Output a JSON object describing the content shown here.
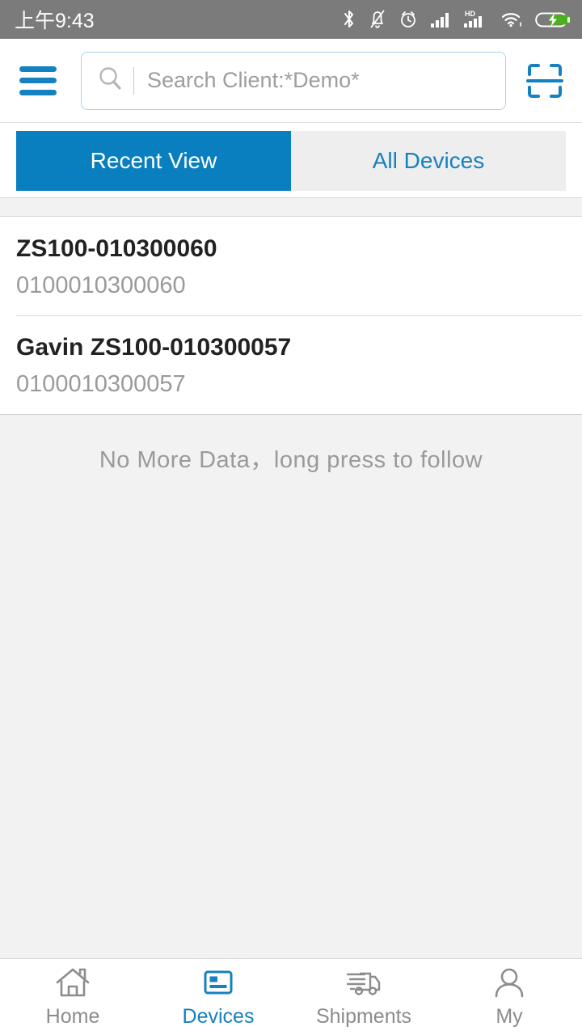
{
  "status_bar": {
    "time": "上午9:43",
    "icons": [
      "bluetooth-icon",
      "bell-muted-icon",
      "alarm-icon",
      "signal-bars-icon",
      "signal-hd-icon",
      "wifi-icon",
      "battery-charging-icon"
    ],
    "background_color": "#7b7b7b",
    "battery_color": "#4caf1e"
  },
  "header": {
    "menu_icon": "hamburger-menu-icon",
    "search": {
      "icon": "search-icon",
      "value": "",
      "placeholder": "Search Client:*Demo*"
    },
    "scan_icon": "barcode-scan-icon",
    "accent_color": "#1581c0"
  },
  "tabs": {
    "items": [
      {
        "label": "Recent View",
        "active": true
      },
      {
        "label": "All Devices",
        "active": false
      }
    ],
    "active_bg": "#0a7fc0",
    "inactive_bg": "#eeeeee",
    "inactive_text": "#1581c0"
  },
  "list": {
    "items": [
      {
        "title": "ZS100-010300060",
        "subtitle": "0100010300060"
      },
      {
        "title": "Gavin ZS100-010300057",
        "subtitle": "0100010300057"
      }
    ]
  },
  "footer_message": "No More Data，long press to follow",
  "bottom_nav": {
    "items": [
      {
        "label": "Home",
        "icon": "home-icon",
        "active": false
      },
      {
        "label": "Devices",
        "icon": "device-card-icon",
        "active": true
      },
      {
        "label": "Shipments",
        "icon": "truck-icon",
        "active": false
      },
      {
        "label": "My",
        "icon": "person-icon",
        "active": false
      }
    ],
    "active_color": "#1581c0",
    "inactive_color": "#8c8c8c"
  }
}
